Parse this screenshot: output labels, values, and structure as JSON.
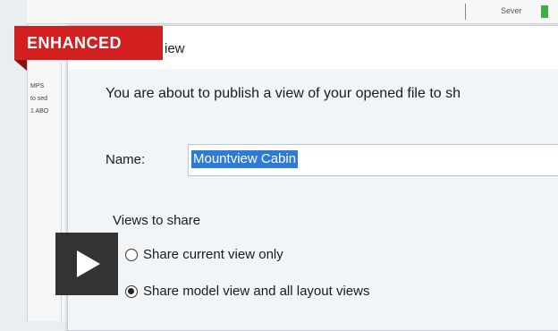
{
  "badge": {
    "label": "ENHANCED"
  },
  "dialog": {
    "title": "iew",
    "intro": "You are about to publish a view of your opened file to sh",
    "name_label": "Name:",
    "name_value": "Mountview Cabin",
    "views_label": "Views to share",
    "options": [
      {
        "label": "Share current view only",
        "checked": false
      },
      {
        "label": "Share model view and all layout views",
        "checked": true
      }
    ]
  },
  "background": {
    "list": [
      "MPS",
      "to sed",
      "1 ABO"
    ],
    "toolbar_text": "Sever"
  },
  "colors": {
    "badge": "#d21f1f",
    "selection": "#2e7bd6",
    "play": "#333333"
  },
  "icons": {
    "play": "play-icon",
    "toolbar": "settings-icon"
  }
}
